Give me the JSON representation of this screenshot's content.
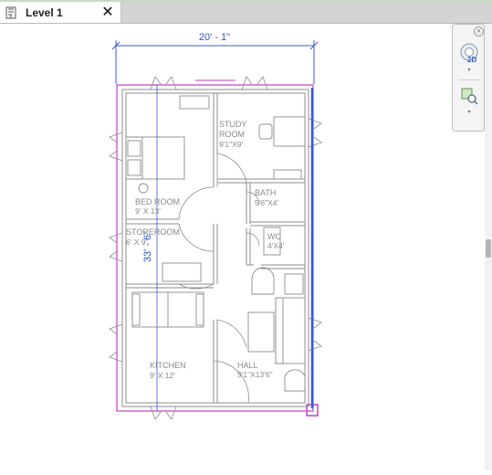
{
  "tab": {
    "title": "Level 1",
    "close": "✕"
  },
  "navbar": {
    "close": "×",
    "wheel_badge": "2D",
    "arrow": "▾"
  },
  "drawing": {
    "width_dimension": "20' - 1\"",
    "height_dimension": "33' - 6\"",
    "rooms": [
      {
        "name": "STUDY",
        "name2": "ROOM",
        "size": "9'1\"X9'"
      },
      {
        "name": "BED ROOM",
        "size": "9' X 13'"
      },
      {
        "name": "BATH",
        "size": "5'6\"X4'"
      },
      {
        "name": "WC",
        "size": "4'X4'"
      },
      {
        "name": "STOREROOM",
        "size": "6' X 9'"
      },
      {
        "name": "KITCHEN",
        "size": "9' X 12'"
      },
      {
        "name": "HALL",
        "size": "9'1\"X13'6\""
      }
    ]
  },
  "colors": {
    "accent_blue": "#3b5bd6",
    "crop_magenta": "#c040c0",
    "wall_gray": "#8c8c8c"
  }
}
